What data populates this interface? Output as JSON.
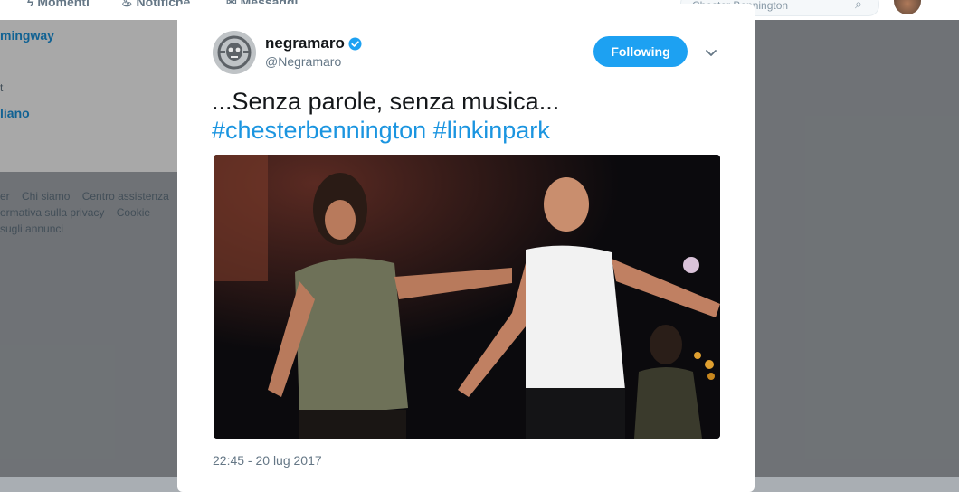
{
  "topbar": {
    "nav": [
      {
        "label": "Momenti",
        "icon": "lightning-icon"
      },
      {
        "label": "Notifiche",
        "icon": "bell-icon"
      },
      {
        "label": "Messaggi",
        "icon": "envelope-icon"
      }
    ],
    "search_value": "Chester Bennington"
  },
  "sidebar": {
    "trends": [
      {
        "label": "mingway"
      },
      {
        "label": "t",
        "kind": "sub"
      },
      {
        "label": "liano"
      }
    ],
    "footer_links": [
      "er",
      "Chi siamo",
      "Centro assistenza",
      "ormativa sulla privacy",
      "Cookie",
      "sugli annunci"
    ]
  },
  "tweet": {
    "author_name": "negramaro",
    "author_handle": "@Negramaro",
    "follow_label": "Following",
    "text_plain": "...Senza parole, senza musica...",
    "hashtags": [
      "#chesterbennington",
      "#linkinpark"
    ],
    "timestamp": "22:45 - 20 lug 2017"
  },
  "colors": {
    "accent": "#1da1f2",
    "link": "#1b95e0",
    "text": "#14171a",
    "muted": "#657786"
  }
}
